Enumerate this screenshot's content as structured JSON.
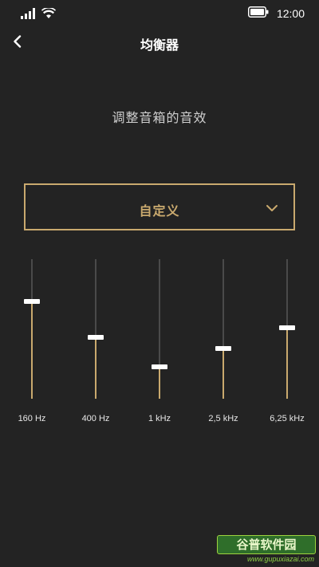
{
  "status_bar": {
    "time": "12:00",
    "icons": [
      "signal-icon",
      "wifi-icon",
      "battery-icon"
    ]
  },
  "header": {
    "title": "均衡器",
    "back_icon": "chevron-left-icon"
  },
  "subtitle": "调整音箱的音效",
  "preset": {
    "selected": "自定义",
    "chevron_icon": "chevron-down-icon"
  },
  "equalizer": {
    "bands": [
      {
        "label": "160 Hz",
        "level": 0.7
      },
      {
        "label": "400 Hz",
        "level": 0.44
      },
      {
        "label": "1 kHz",
        "level": 0.23
      },
      {
        "label": "2,5 kHz",
        "level": 0.36
      },
      {
        "label": "6,25 kHz",
        "level": 0.51
      }
    ]
  },
  "watermark": {
    "logo": "谷普软件园",
    "url": "www.gupuxiazai.com"
  },
  "colors": {
    "background": "#232323",
    "accent": "#c9a96e",
    "track": "#4a4a4a",
    "thumb": "#ffffff"
  }
}
